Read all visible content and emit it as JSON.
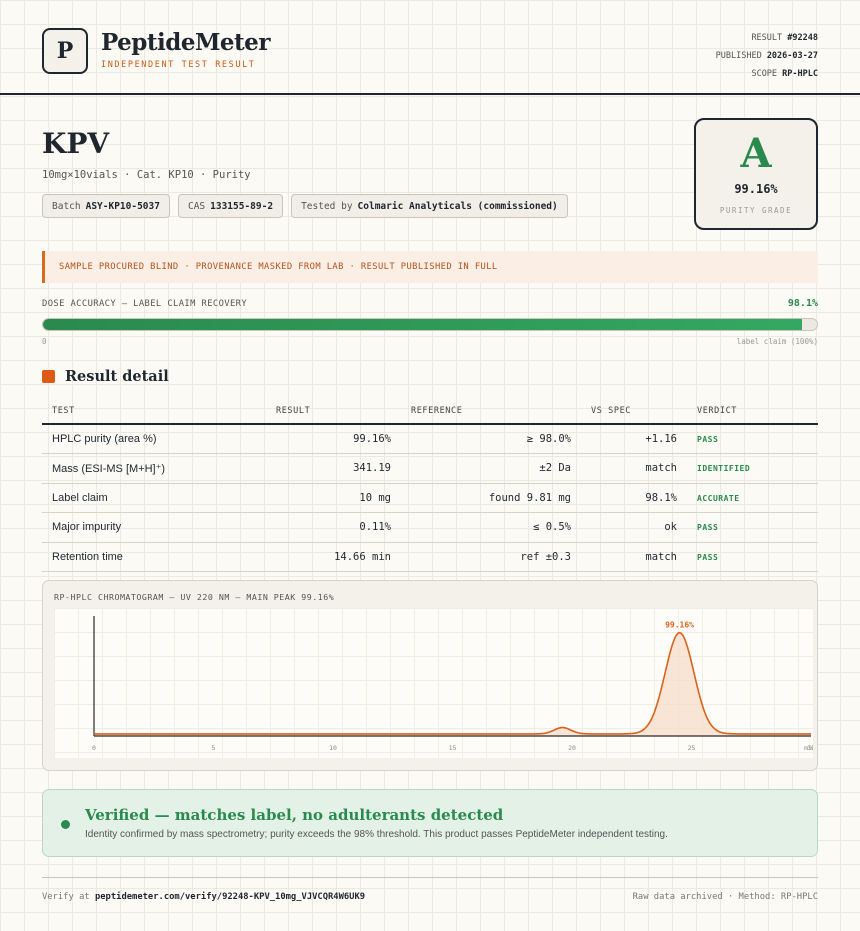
{
  "header": {
    "logo_letter": "P",
    "brand": "PeptideMeter",
    "subtitle": "INDEPENDENT TEST RESULT",
    "result_label": "RESULT",
    "result_value": "#92248",
    "published_label": "PUBLISHED",
    "published_value": "2026-03-27",
    "scope_label": "SCOPE",
    "scope_value": "RP-HPLC"
  },
  "product": {
    "name": "KPV",
    "subtitle": "10mg×10vials · Cat. KP10 · Purity",
    "chips": [
      {
        "label": "Batch",
        "value": "ASY-KP10-5037"
      },
      {
        "label": "CAS",
        "value": "133155-89-2"
      },
      {
        "label": "Tested by",
        "value": "Colmaric Analyticals (commissioned)"
      }
    ]
  },
  "grade": {
    "letter": "A",
    "value": "99.16%",
    "label": "PURITY GRADE",
    "color": "#2a8a4e"
  },
  "notice": "SAMPLE PROCURED BLIND · PROVENANCE MASKED FROM LAB · RESULT PUBLISHED IN FULL",
  "dose": {
    "label": "DOSE ACCURACY — LABEL CLAIM RECOVERY",
    "value_text": "98.1%",
    "fraction": 0.981,
    "min_label": "0",
    "max_label": "label claim (100%)"
  },
  "section_title": "Result detail",
  "table": {
    "headers": [
      "TEST",
      "RESULT",
      "REFERENCE",
      "VS SPEC",
      "VERDICT"
    ],
    "rows": [
      {
        "test": "HPLC purity (area %)",
        "result": "99.16%",
        "reference": "≥ 98.0%",
        "vs": "+1.16",
        "verdict": "PASS"
      },
      {
        "test": "Mass (ESI-MS [M+H]⁺)",
        "result": "341.19",
        "reference": "±2 Da",
        "vs": "match",
        "verdict": "IDENTIFIED"
      },
      {
        "test": "Label claim",
        "result": "10 mg",
        "reference": "found 9.81 mg",
        "vs": "98.1%",
        "verdict": "ACCURATE"
      },
      {
        "test": "Major impurity",
        "result": "0.11%",
        "reference": "≤ 0.5%",
        "vs": "ok",
        "verdict": "PASS"
      },
      {
        "test": "Retention time",
        "result": "14.66 min",
        "reference": "ref ±0.3",
        "vs": "match",
        "verdict": "PASS"
      }
    ]
  },
  "chromatogram": {
    "title": "RP-HPLC CHROMATOGRAM — UV 220 NM — MAIN PEAK 99.16%"
  },
  "chart_data": {
    "type": "line",
    "title": "RP-HPLC CHROMATOGRAM — UV 220 NM — MAIN PEAK 99.16%",
    "xlabel": "min",
    "ylabel": "",
    "xlim": [
      0,
      30
    ],
    "ylim": [
      0,
      1.1
    ],
    "x_ticks": [
      "0",
      "5",
      "10",
      "15",
      "20",
      "25",
      "30"
    ],
    "peaks": [
      {
        "center": 19.6,
        "height": 0.06,
        "width": 0.35
      },
      {
        "center": 24.5,
        "height": 0.96,
        "width": 0.6
      }
    ],
    "baseline": 0.02,
    "peak_label": "99.16%",
    "line_color": "#d8631a",
    "fill_color": "#f6dcc6"
  },
  "verified": {
    "title": "Verified — matches label, no adulterants detected",
    "desc": "Identity confirmed by mass spectrometry; purity exceeds the 98% threshold. This product passes PeptideMeter independent testing."
  },
  "footer": {
    "verify_prefix": "Verify at",
    "verify_url": "peptidemeter.com/verify/92248-KPV_10mg_VJVCQR4W6UK9",
    "right_text": "Raw data archived · Method: RP-HPLC"
  }
}
